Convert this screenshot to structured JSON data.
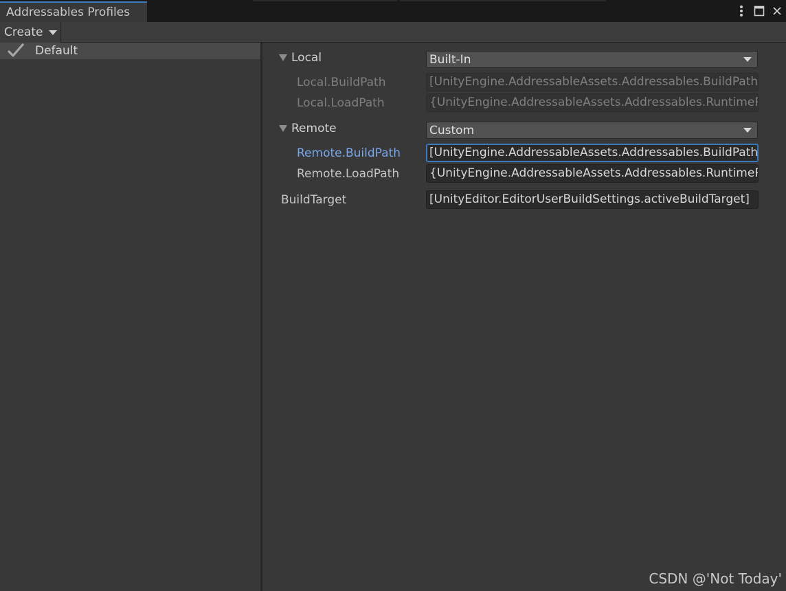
{
  "window": {
    "tab_title": "Addressables Profiles"
  },
  "toolbar": {
    "create_label": "Create"
  },
  "profiles": [
    {
      "name": "Default",
      "selected": true
    }
  ],
  "groups": [
    {
      "name": "Local",
      "mode": "Built-In",
      "paths": [
        {
          "label": "Local.BuildPath",
          "value": "[UnityEngine.AddressableAssets.Addressables.BuildPath]",
          "state": "disabled"
        },
        {
          "label": "Local.LoadPath",
          "value": "{UnityEngine.AddressableAssets.Addressables.RuntimePath}",
          "state": "disabled"
        }
      ]
    },
    {
      "name": "Remote",
      "mode": "Custom",
      "paths": [
        {
          "label": "Remote.BuildPath",
          "value": "[UnityEngine.AddressableAssets.Addressables.BuildPath]",
          "state": "focused"
        },
        {
          "label": "Remote.LoadPath",
          "value": "{UnityEngine.AddressableAssets.Addressables.RuntimePath}",
          "state": "normal"
        }
      ]
    }
  ],
  "build_target": {
    "label": "BuildTarget",
    "value": "[UnityEditor.EditorUserBuildSettings.activeBuildTarget]"
  },
  "watermark": "CSDN @'Not Today'",
  "colors": {
    "accent": "#3a79bb",
    "focused_label": "#79a7ea",
    "background": "#383838"
  }
}
